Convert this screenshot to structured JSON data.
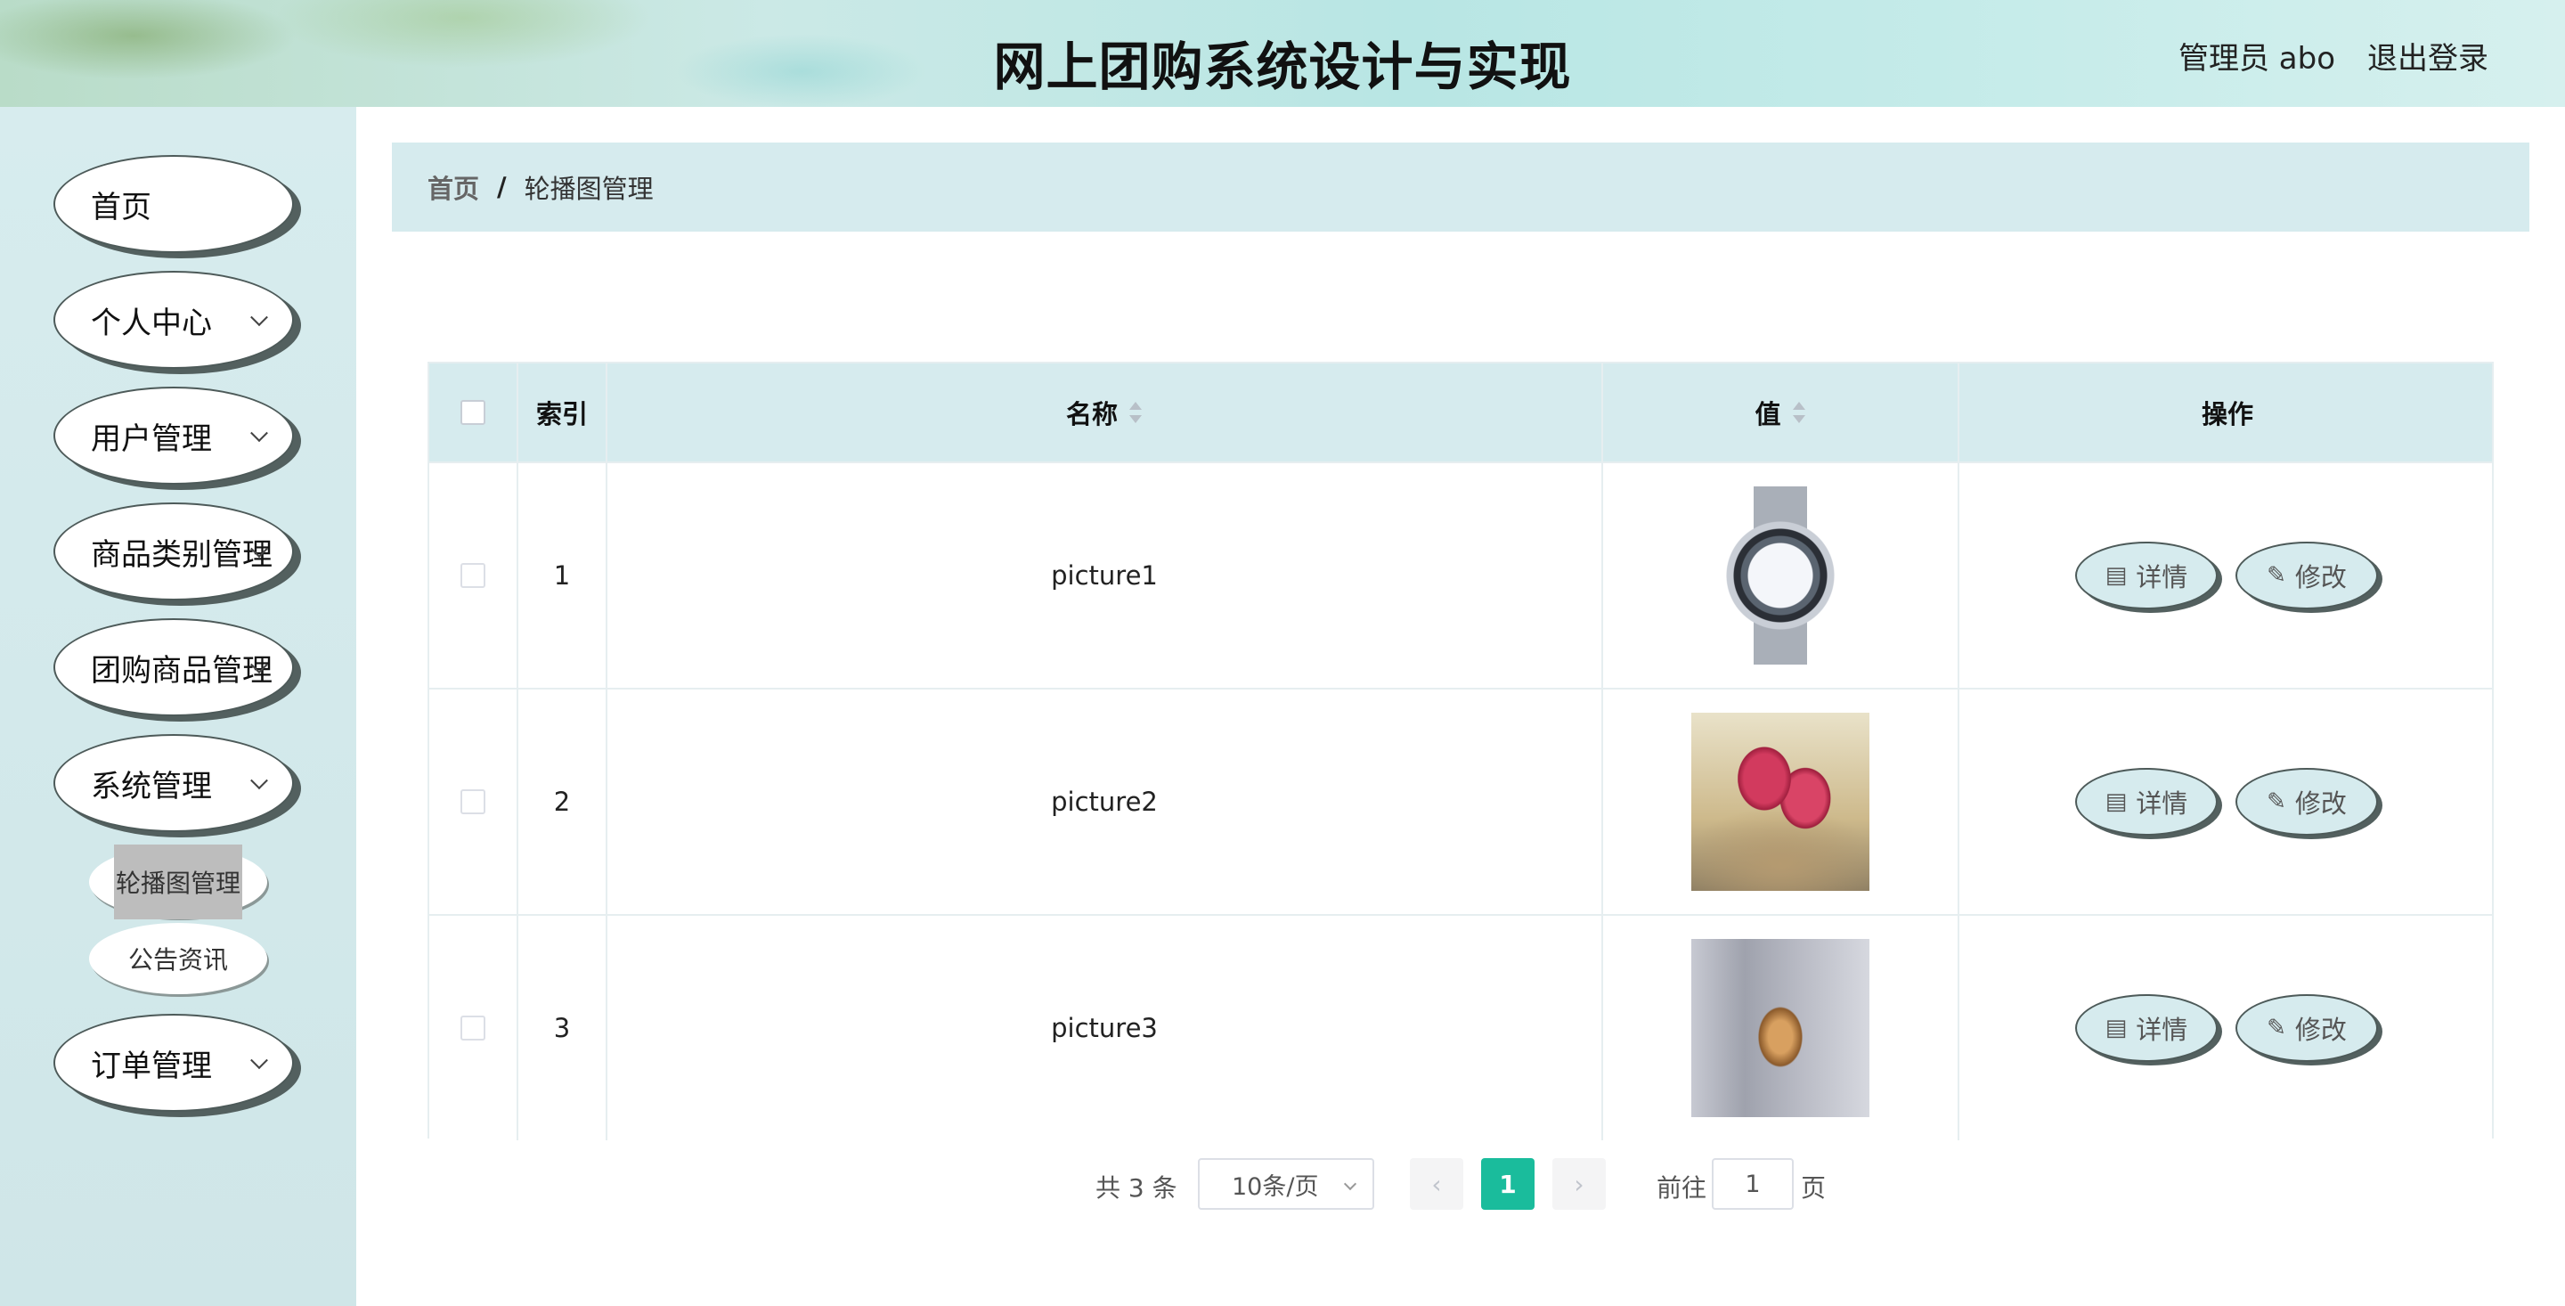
{
  "header": {
    "title": "网上团购系统设计与实现",
    "user_label": "管理员 abo",
    "logout_label": "退出登录"
  },
  "sidebar": {
    "items": [
      {
        "label": "首页",
        "has_children": false
      },
      {
        "label": "个人中心",
        "has_children": true
      },
      {
        "label": "用户管理",
        "has_children": true
      },
      {
        "label": "商品类别管理",
        "has_children": true
      },
      {
        "label": "团购商品管理",
        "has_children": true
      },
      {
        "label": "系统管理",
        "has_children": true,
        "expanded": true
      },
      {
        "label": "订单管理",
        "has_children": true
      }
    ],
    "sub_items": [
      {
        "label": "轮播图管理",
        "active": true
      },
      {
        "label": "公告资讯",
        "active": false
      }
    ]
  },
  "breadcrumb": {
    "home": "首页",
    "separator": "/",
    "current": "轮播图管理"
  },
  "table": {
    "headers": {
      "index": "索引",
      "name": "名称",
      "value": "值",
      "actions": "操作"
    },
    "rows": [
      {
        "index": "1",
        "name": "picture1",
        "image": "wristwatch"
      },
      {
        "index": "2",
        "name": "picture2",
        "image": "pink-roses"
      },
      {
        "index": "3",
        "name": "picture3",
        "image": "heart-pendant"
      }
    ],
    "detail_label": "详情",
    "edit_label": "修改"
  },
  "pagination": {
    "total": "共 3 条",
    "page_size": "10条/页",
    "current_page": "1",
    "goto_label": "前往",
    "goto_value": "1",
    "page_suffix": "页",
    "accent": "#1abc9c"
  },
  "colors": {
    "sidebar_bg": "#d7ecee",
    "table_header_bg": "#d6ebee",
    "breadcrumb_bg": "#d6ebee"
  }
}
